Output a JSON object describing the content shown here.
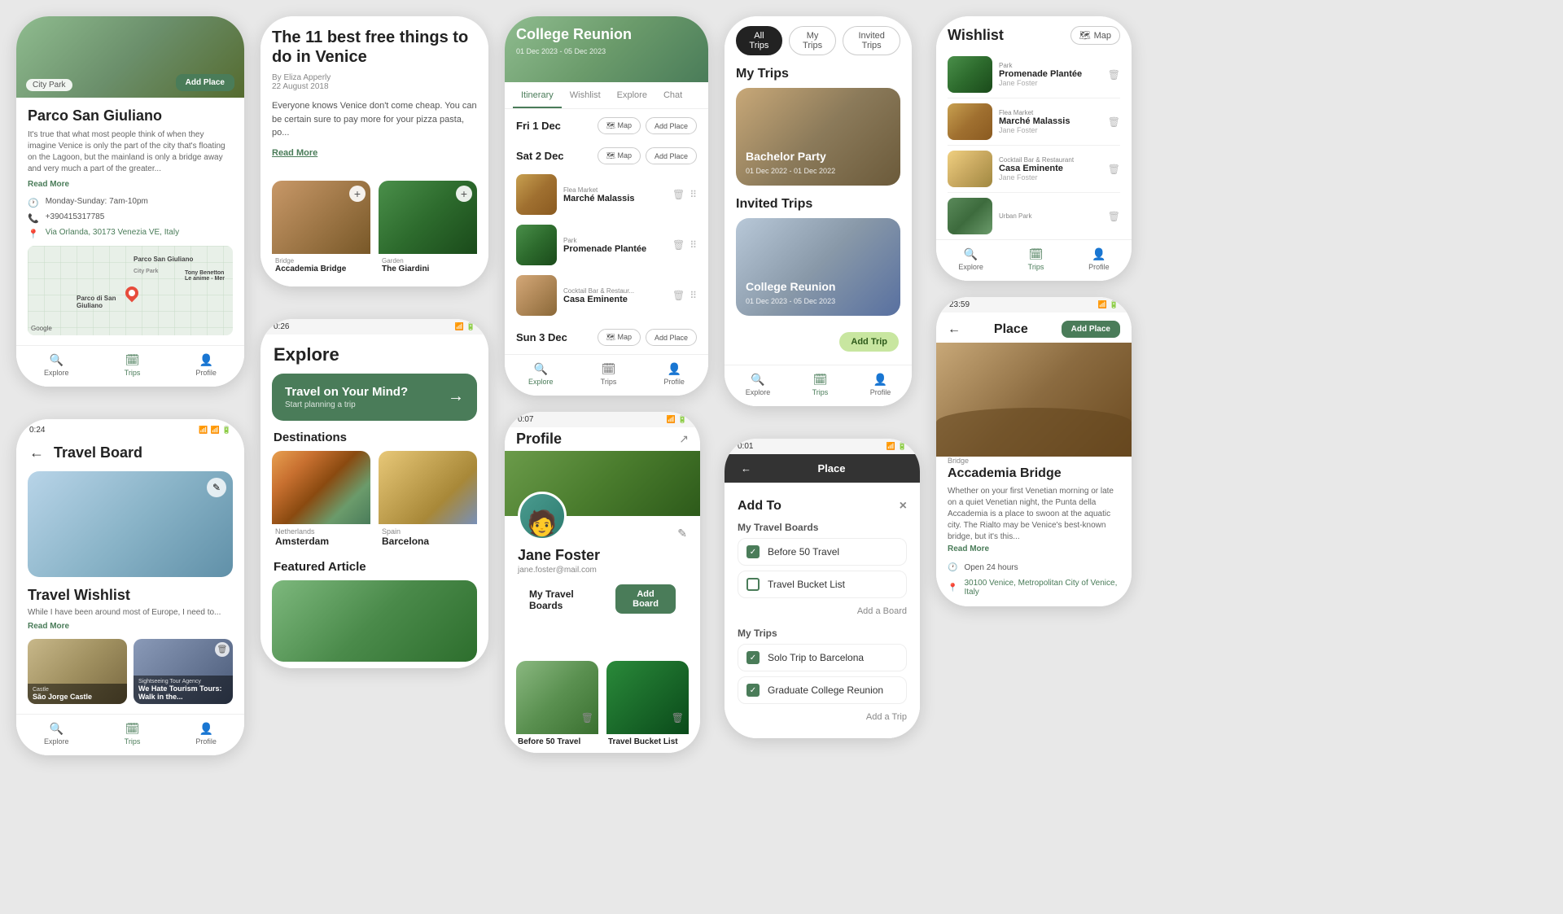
{
  "phones": {
    "place_parco": {
      "title": "Parco San Giuliano",
      "category": "City Park",
      "add_place_label": "Add Place",
      "description": "It's true that what most people think of when they imagine Venice is only the part of the city that's floating on the Lagoon, but the mainland is only a bridge away and very much a part of the greater...",
      "read_more": "Read More",
      "hours": "Monday-Sunday: 7am-10pm",
      "phone": "+390415317785",
      "address": "Via Orlanda, 30173 Venezia VE, Italy",
      "nav": {
        "explore": "Explore",
        "trips": "Trips",
        "profile": "Profile"
      }
    },
    "travel_board": {
      "header_back": "←",
      "header_title": "Travel Board",
      "wishlist_title": "Travel Wishlist",
      "description": "While I have been around most of Europe, I need to...",
      "read_more": "Read More",
      "items": [
        {
          "type": "Castle",
          "name": "São Jorge Castle"
        },
        {
          "type": "Sightseeing Tour Agency",
          "name": "We Hate Tourism Tours: Walk in the..."
        }
      ]
    },
    "article": {
      "title": "The 11 best free things to do in Venice",
      "author": "By Eliza Apperly",
      "date": "22 August 2018",
      "body": "Everyone knows Venice don't come cheap. You can be certain sure to pay more for your pizza pasta, po...",
      "read_more": "Read More",
      "image_cards": [
        {
          "type": "Bridge",
          "name": "Accademia Bridge"
        },
        {
          "type": "Garden",
          "name": "The Giardini"
        }
      ]
    },
    "explore": {
      "title": "Explore",
      "banner_main": "Travel on Your Mind?",
      "banner_sub": "Start planning a trip",
      "destinations_title": "Destinations",
      "featured_title": "Featured Article",
      "destinations": [
        {
          "country": "Netherlands",
          "city": "Amsterdam"
        },
        {
          "country": "Spain",
          "city": "Barcelona"
        }
      ]
    },
    "itinerary": {
      "trip_name": "College Reunion",
      "trip_dates": "01 Dec 2023 - 05 Dec 2023",
      "tabs": [
        "Itinerary",
        "Wishlist",
        "Explore",
        "Chat"
      ],
      "active_tab": "Itinerary",
      "days": [
        {
          "label": "Fri 1 Dec",
          "places": []
        },
        {
          "label": "Sat 2 Dec",
          "places": [
            {
              "type": "Flea Market",
              "name": "Marché Malassis"
            },
            {
              "type": "Park",
              "name": "Promenade Plantée"
            },
            {
              "type": "Cocktail Bar & Restaur...",
              "name": "Casa Eminente"
            }
          ]
        },
        {
          "label": "Sun 3 Dec",
          "places": []
        }
      ]
    },
    "profile": {
      "name": "Jane Foster",
      "email": "jane.foster@mail.com",
      "boards_label": "My Travel Boards",
      "add_board": "Add Board",
      "edit_icon": "✎",
      "boards": [
        {
          "name": "Before 50 Travel"
        },
        {
          "name": "Travel Bucket List"
        }
      ]
    },
    "my_trips": {
      "filter_tabs": [
        "All Trips",
        "My Trips",
        "Invited Trips"
      ],
      "active_filter": "All Trips",
      "sections": {
        "my_trips_title": "My Trips",
        "invited_trips_title": "Invited Trips"
      },
      "trips": [
        {
          "name": "Bachelor Party",
          "dates": "01 Dec 2022 - 01 Dec 2022"
        },
        {
          "name": "College Reunion",
          "dates": "01 Dec 2023 - 05 Dec 2023"
        }
      ],
      "add_trip_btn": "Add Trip"
    },
    "add_to": {
      "title": "Add To",
      "close": "×",
      "boards_section": "My Travel Boards",
      "trips_section": "My Trips",
      "boards": [
        {
          "label": "Before 50 Travel",
          "checked": true
        },
        {
          "label": "Travel Bucket List",
          "checked": false
        }
      ],
      "trips": [
        {
          "label": "Solo Trip to Barcelona",
          "checked": true
        },
        {
          "label": "Graduate College Reunion",
          "checked": true
        }
      ],
      "add_board_link": "Add a Board",
      "add_trip_link": "Add a Trip",
      "place_title": "Place"
    },
    "wishlist_sidebar": {
      "title": "Wishlist",
      "map_btn": "Map",
      "items": [
        {
          "type": "Park",
          "name": "Promenade Plantée",
          "author": "Jane Foster"
        },
        {
          "type": "Flea Market",
          "name": "Marché Malassis",
          "author": "Jane Foster"
        },
        {
          "type": "Cocktail Bar & Restaurant",
          "name": "Casa Eminente",
          "author": "Jane Foster"
        },
        {
          "type": "Urban Park",
          "name": "",
          "author": ""
        }
      ],
      "nav": {
        "explore": "Explore",
        "trips": "Trips",
        "profile": "Profile"
      }
    },
    "place_accademia": {
      "back": "←",
      "title": "Place",
      "add_place": "Add Place",
      "type": "Bridge",
      "name": "Accademia Bridge",
      "description": "Whether on your first Venetian morning or late on a quiet Venetian night, the Punta della Accademia is a place to swoon at the aquatic city. The Rialto may be Venice's best-known bridge, but it's this...",
      "read_more": "Read More",
      "hours": "Open 24 hours",
      "address": "30100 Venice, Metropolitan City of Venice, Italy"
    }
  }
}
